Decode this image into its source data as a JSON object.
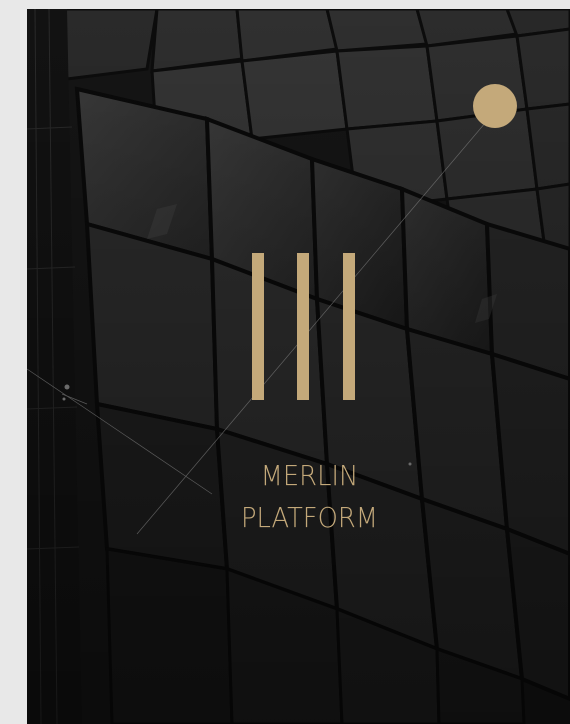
{
  "brand": {
    "line1": "MERLIN",
    "line2": "PLATFORM"
  },
  "colors": {
    "gold": "#c4a97a",
    "background": "#141414",
    "page": "#e8e8e8"
  },
  "icons": {
    "logo": "three-vertical-bars-logo",
    "accent": "gold-circle"
  }
}
